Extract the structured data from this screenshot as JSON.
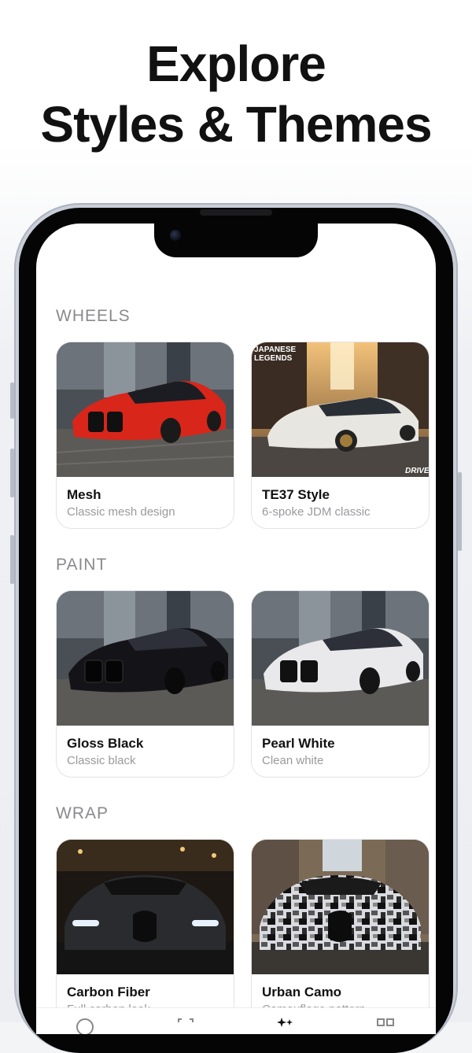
{
  "headline": {
    "line1": "Explore",
    "line2": "Styles & Themes"
  },
  "sections": [
    {
      "title": "WHEELS",
      "cards": [
        {
          "name": "Mesh",
          "desc": "Classic mesh design",
          "car_color": "#d8261b"
        },
        {
          "name": "TE37 Style",
          "desc": "6-spoke JDM classic",
          "car_color": "#e8e6e1",
          "overlay_text_1": "JAPANESE",
          "overlay_text_2": "LEGENDS",
          "overlay_text_3": "DRIVE"
        }
      ]
    },
    {
      "title": "PAINT",
      "cards": [
        {
          "name": "Gloss Black",
          "desc": "Classic black",
          "car_color": "#141418"
        },
        {
          "name": "Pearl White",
          "desc": "Clean white",
          "car_color": "#e9e9ec"
        }
      ]
    },
    {
      "title": "WRAP",
      "cards": [
        {
          "name": "Carbon Fiber",
          "desc": "Full carbon look",
          "car_color": "#2a2b2e"
        },
        {
          "name": "Urban Camo",
          "desc": "Camouflage pattern",
          "car_color": "#6b6f76"
        }
      ]
    }
  ],
  "tabbar": {
    "icons": [
      "home-icon",
      "scan-icon",
      "sparkles-icon",
      "grid-icon"
    ]
  }
}
